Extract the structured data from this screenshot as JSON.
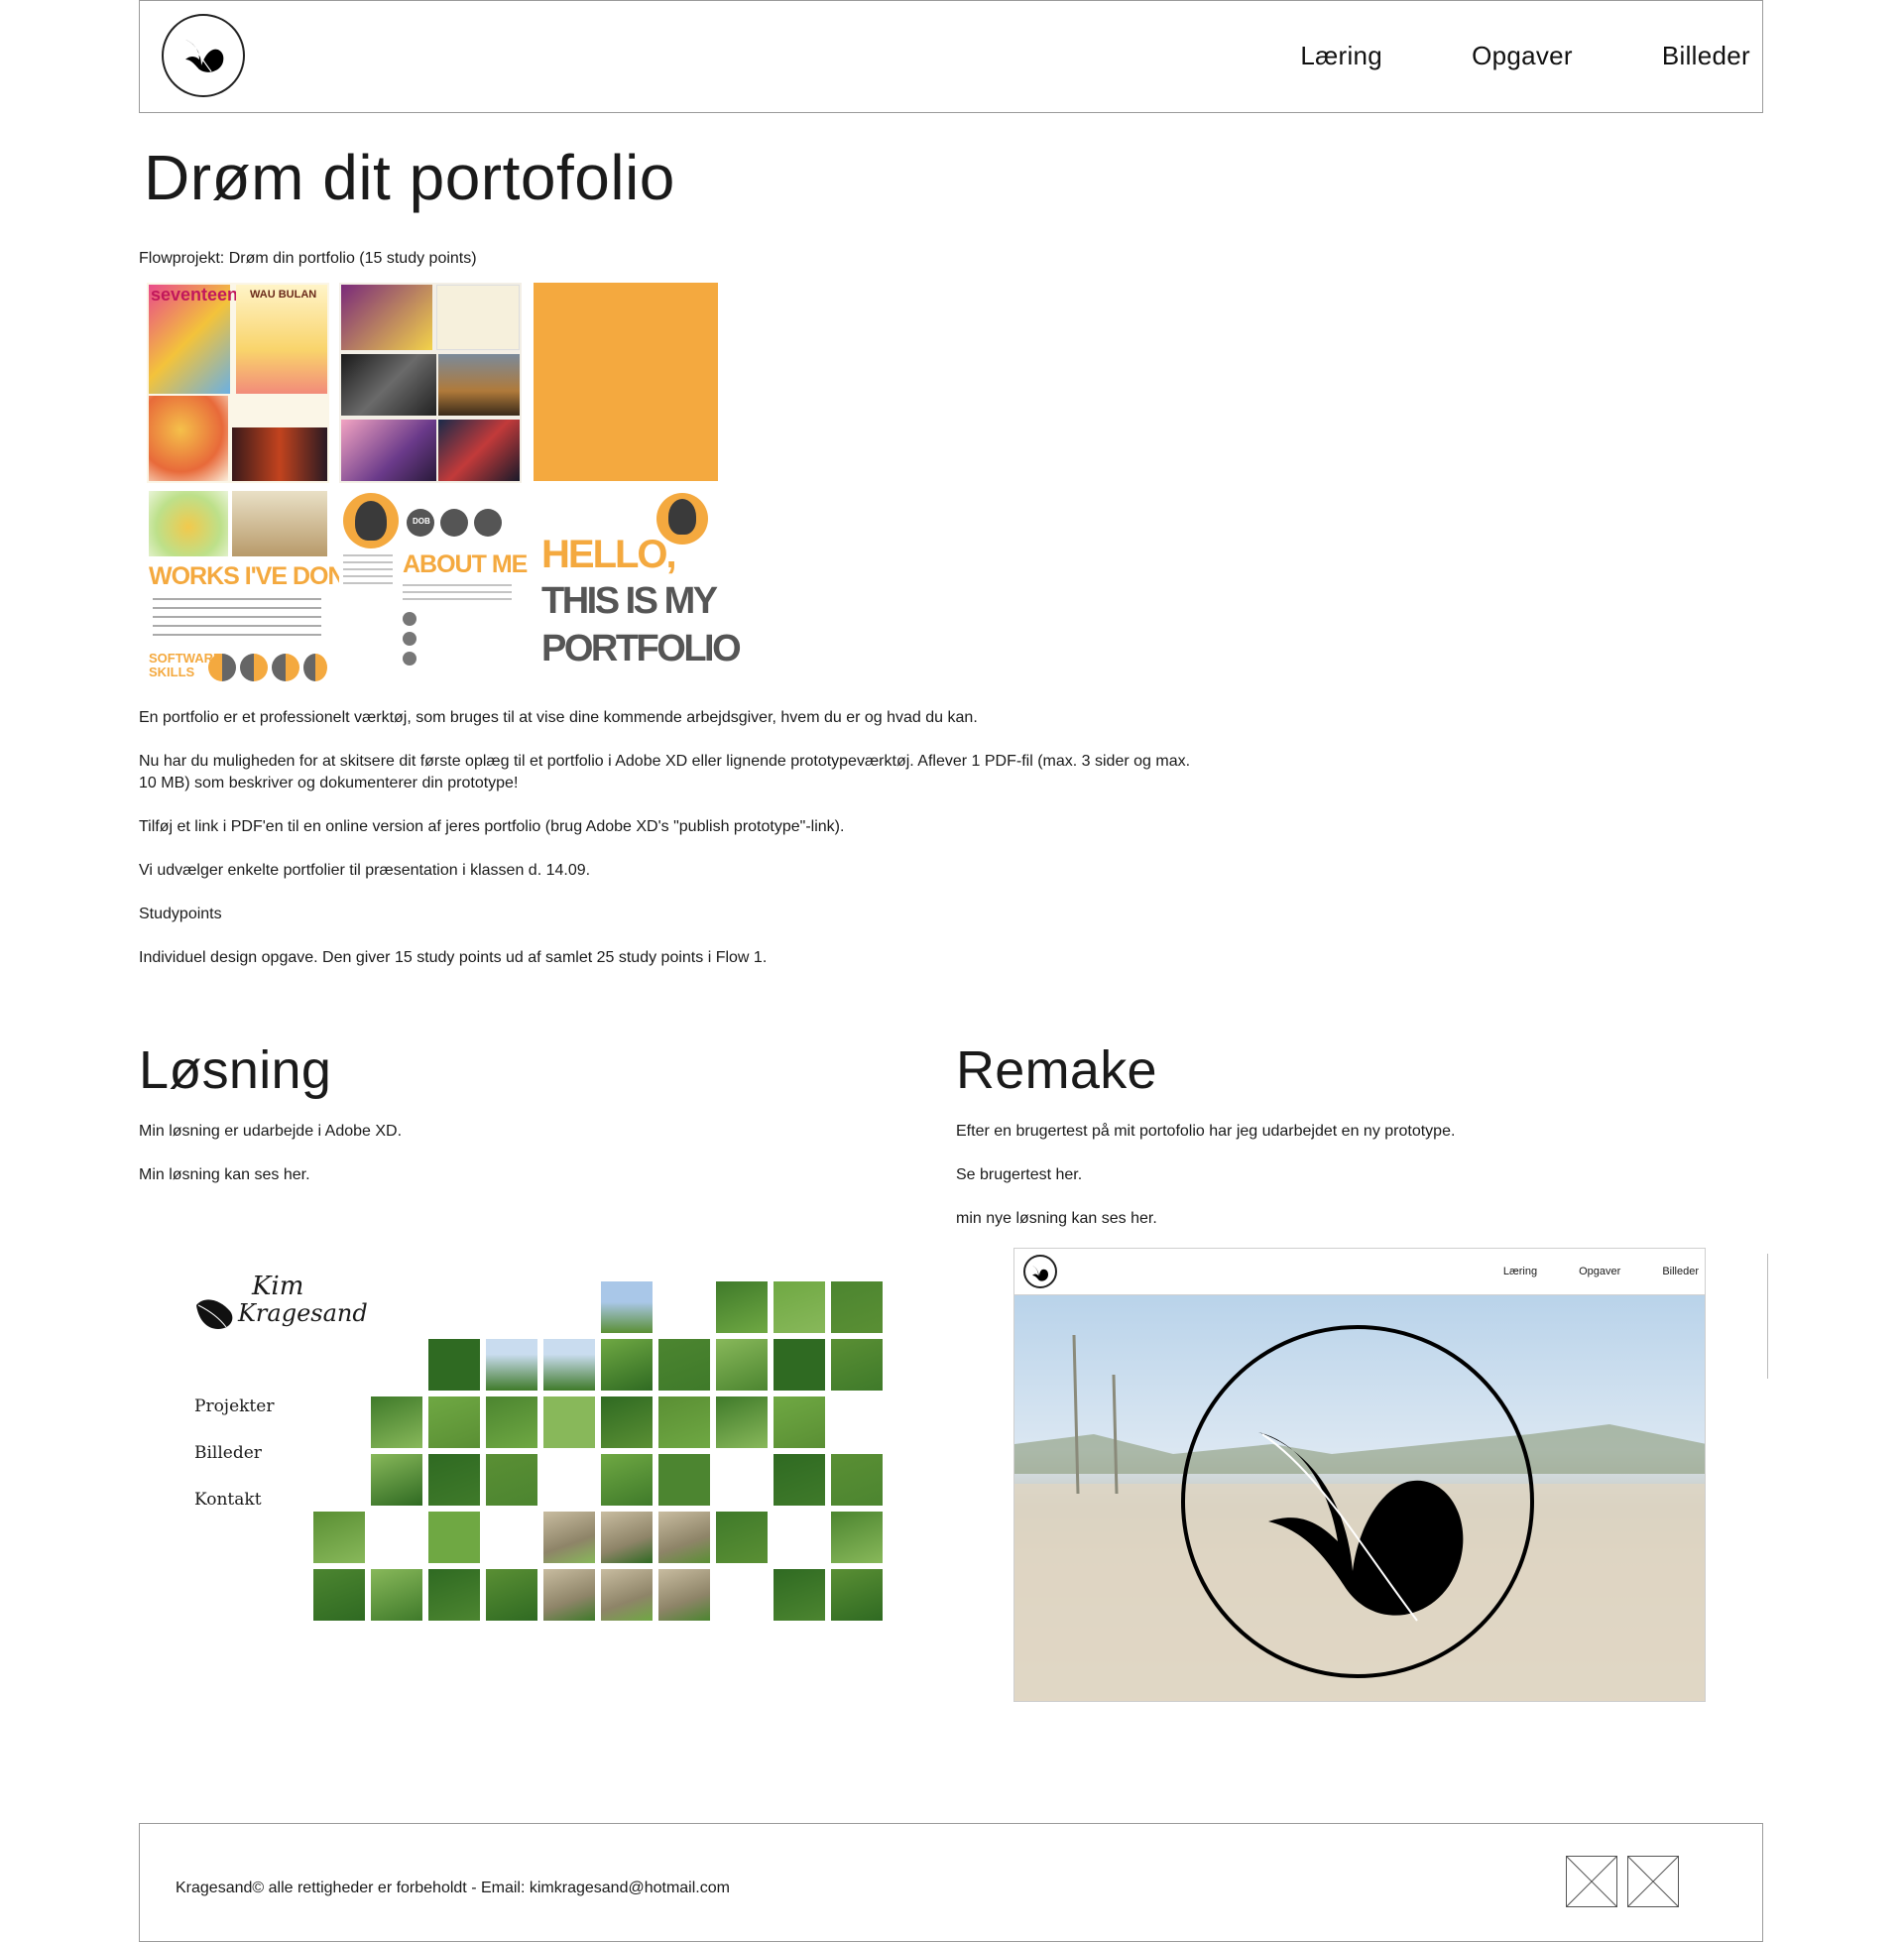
{
  "header": {
    "nav": [
      "Læring",
      "Opgaver",
      "Billeder"
    ]
  },
  "main": {
    "title": "Drøm dit portofolio",
    "lead": "Flowprojekt: Drøm din portfolio (15 study points)",
    "collage": {
      "magazine_masthead": "seventeen",
      "magazine_cover_text": "WAU BULAN",
      "works_heading": "WORKS I'VE DONE",
      "software_heading": "SOFTWARE SKILLS",
      "about_heading": "ABOUT ME",
      "dob_badge": "DOB",
      "cover_line1": "HELLO,",
      "cover_line2": "THIS IS MY",
      "cover_line3": "PORTFOLIO"
    },
    "paragraphs": [
      "En portfolio er et professionelt værktøj, som bruges til at vise dine kommende arbejdsgiver, hvem du er og hvad du kan.",
      "Nu har du muligheden for at skitsere dit første oplæg til et portfolio i Adobe XD eller lignende prototypeværktøj. Aflever 1 PDF-fil (max. 3 sider og max. 10 MB) som beskriver og dokumenterer din prototype!",
      "Tilføj et link i PDF'en til en online version af jeres portfolio (brug Adobe XD's \"publish prototype\"-link).",
      "Vi udvælger enkelte portfolier til præsentation i klassen d. 14.09.",
      "Studypoints",
      "Individuel design opgave. Den giver 15 study points ud af samlet 25 study points i Flow 1."
    ]
  },
  "losning": {
    "title": "Løsning",
    "text1": "Min løsning er udarbejde i Adobe XD.",
    "text2": "Min løsning kan ses her.",
    "mock": {
      "brand_line1": "Kim",
      "brand_line2": "Kragesand",
      "menu": [
        "Projekter",
        "Billeder",
        "Kontakt"
      ]
    }
  },
  "remake": {
    "title": "Remake",
    "text1": "Efter en brugertest på mit portofolio har jeg udarbejdet en ny prototype.",
    "text2": "Se brugertest her.",
    "text3": "min nye løsning kan ses her.",
    "mock_nav": [
      "Læring",
      "Opgaver",
      "Billeder"
    ]
  },
  "footer": {
    "text": "Kragesand© alle rettigheder er forbeholdt - Email: kimkragesand@hotmail.com",
    "icons": [
      "placeholder-icon",
      "placeholder-icon"
    ]
  },
  "colors": {
    "accent_orange": "#f4a93f",
    "grass_green": "#4e8a2c",
    "border": "#9a9a9a"
  }
}
